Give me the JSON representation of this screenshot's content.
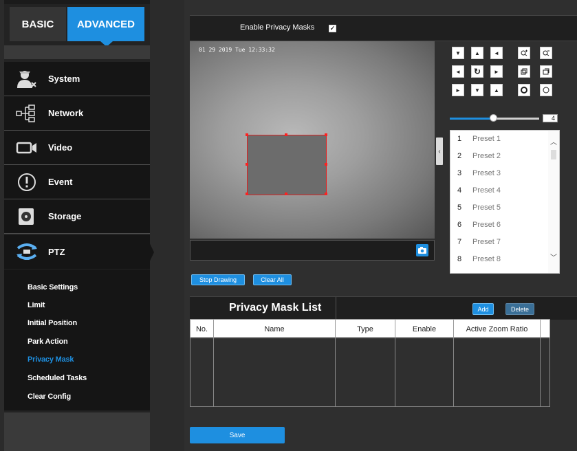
{
  "tabs": {
    "basic": "BASIC",
    "advanced": "ADVANCED"
  },
  "menu": [
    {
      "label": "System",
      "icon": "user-gear-icon"
    },
    {
      "label": "Network",
      "icon": "network-icon"
    },
    {
      "label": "Video",
      "icon": "video-camera-icon"
    },
    {
      "label": "Event",
      "icon": "alert-icon"
    },
    {
      "label": "Storage",
      "icon": "hard-drive-icon"
    },
    {
      "label": "PTZ",
      "icon": "ptz-arrows-icon"
    }
  ],
  "submenu": [
    "Basic Settings",
    "Limit",
    "Initial Position",
    "Park Action",
    "Privacy Mask",
    "Scheduled Tasks",
    "Clear Config"
  ],
  "submenu_selected": "Privacy Mask",
  "enable_privacy": {
    "label": "Enable Privacy Masks",
    "checked": true
  },
  "video": {
    "osd_text": "01 29 2019 Tue 12:33:32"
  },
  "ptz": {
    "speed": "4",
    "speed_fraction": 0.45
  },
  "presets": [
    {
      "num": "1",
      "name": "Preset 1"
    },
    {
      "num": "2",
      "name": "Preset 2"
    },
    {
      "num": "3",
      "name": "Preset 3"
    },
    {
      "num": "4",
      "name": "Preset 4"
    },
    {
      "num": "5",
      "name": "Preset 5"
    },
    {
      "num": "6",
      "name": "Preset 6"
    },
    {
      "num": "7",
      "name": "Preset 7"
    },
    {
      "num": "8",
      "name": "Preset 8"
    }
  ],
  "drawing": {
    "stop": "Stop Drawing",
    "clear": "Clear All"
  },
  "mask_list": {
    "title": "Privacy Mask List",
    "add": "Add",
    "delete": "Delete",
    "columns": [
      "No.",
      "Name",
      "Type",
      "Enable",
      "Active Zoom Ratio"
    ]
  },
  "save": "Save",
  "colors": {
    "accent": "#1e8fe0",
    "mask_border": "#e02020"
  }
}
